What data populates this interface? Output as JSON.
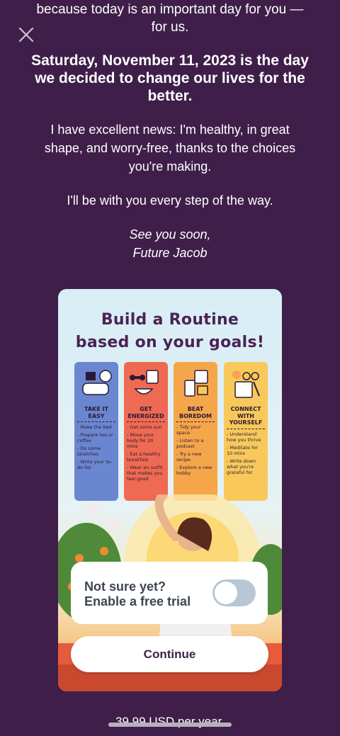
{
  "letter": {
    "intro": "because today is an important day for you — for us.",
    "headline": "Saturday, November 11, 2023 is the day we decided to change our lives for the better.",
    "para1": "I have excellent news: I'm healthy, in great shape, and worry-free, thanks to the choices you're making.",
    "para2": "I'll be with you every step of the way.",
    "sign_line1": "See you soon,",
    "sign_line2": "Future Jacob"
  },
  "card": {
    "title_line1": "Build a Routine",
    "title_line2": "based on your goals!",
    "columns": [
      {
        "heading": "TAKE IT EASY",
        "color": "#6b86d1",
        "icon": "pillow-bed-icon",
        "items": [
          "- Make the bed",
          "- Prepare tea or coffee",
          "- Do some stretches",
          "- Write your to-do list"
        ]
      },
      {
        "heading": "GET ENERGIZED",
        "color": "#ef6a52",
        "icon": "dumbbell-bowl-icon",
        "items": [
          "- Get some sun",
          "- Move your body for 20 mins",
          "- Eat a healthy breakfast",
          "- Wear an outfit that makes you feel good"
        ]
      },
      {
        "heading": "BEAT BOREDOM",
        "color": "#f6a64a",
        "icon": "calendar-phone-icon",
        "items": [
          "- Tidy your space",
          "- Listen to a podcast",
          "- Try a new recipe",
          "- Explore a new hobby"
        ]
      },
      {
        "heading": "CONNECT WITH YOURSELF",
        "color": "#f8c95a",
        "icon": "journal-glasses-icon",
        "items": [
          "- Understand how you thrive",
          "- Meditate for 10 mins",
          "- Write down what you're grateful for"
        ]
      }
    ]
  },
  "trial": {
    "line1": "Not sure yet?",
    "line2": "Enable a free trial",
    "enabled": false
  },
  "continue_label": "Continue",
  "price_text": "39.99 USD per year."
}
